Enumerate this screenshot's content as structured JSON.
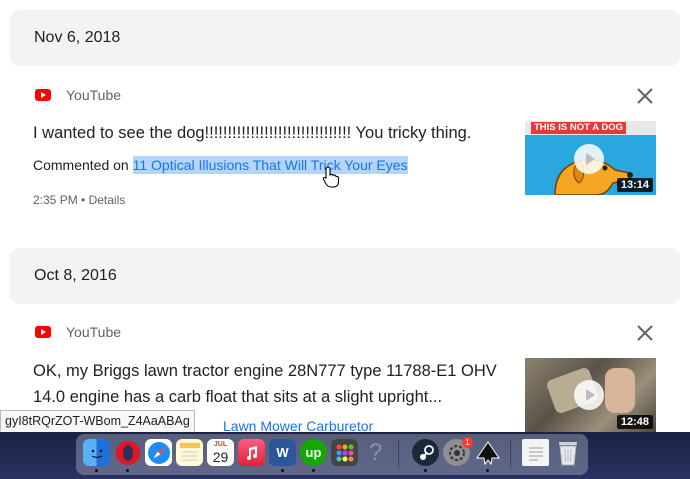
{
  "entries": [
    {
      "date": "Nov 6, 2018",
      "source": "YouTube",
      "comment": "I wanted to see the dog!!!!!!!!!!!!!!!!!!!!!!!!!!!!!!!! You tricky thing.",
      "commented_prefix": "Commented on",
      "video_title": "11 Optical Illusions That Will Trick Your Eyes",
      "time": "2:35 PM",
      "details_label": "Details",
      "thumb_banner": "THIS IS NOT A DOG",
      "duration": "13:14"
    },
    {
      "date": "Oct 8, 2016",
      "source": "YouTube",
      "comment_line1": "OK, my Briggs lawn tractor engine 28N777 type 11788-E1 OHV",
      "comment_line2": "14.0 engine has a carb float that sits at a slight upright...",
      "video_title_partial": "Lawn Mower Carburetor",
      "duration": "12:48"
    }
  ],
  "tooltip": "gyI8tRQrZOT-WBom_Z4AaABAg",
  "dock": {
    "calendar_month": "JUL",
    "calendar_day": "29",
    "word_label": "W",
    "upwork_label": "up",
    "help_label": "?",
    "notification_badge": "1"
  },
  "colors": {
    "link": "#1a73e8",
    "selection": "#b3d4fc",
    "header_bg": "#f1f3f4",
    "youtube_red": "#ff0000"
  }
}
